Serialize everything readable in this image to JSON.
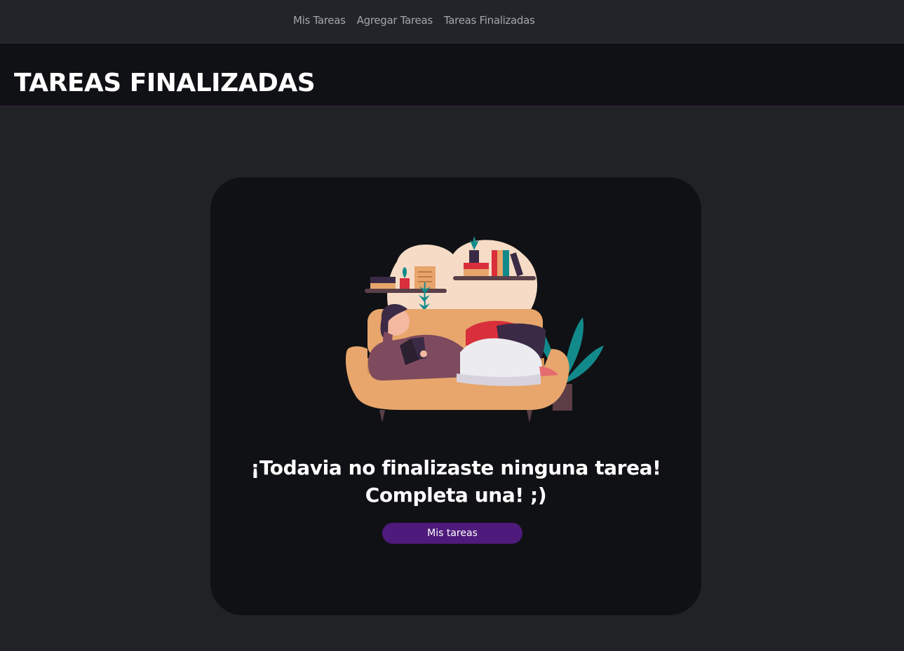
{
  "nav": {
    "items": [
      {
        "label": "Mis Tareas"
      },
      {
        "label": "Agregar Tareas"
      },
      {
        "label": "Tareas Finalizadas"
      }
    ]
  },
  "header": {
    "title": "TAREAS FINALIZADAS"
  },
  "empty_state": {
    "illustration_icon": "woman-reading-on-sofa-illustration",
    "message_line1": "¡Todavia no finalizaste ninguna tarea!",
    "message_line2": "Completa una! ;)",
    "button_label": "Mis tareas"
  },
  "colors": {
    "navbar_bg": "#212429",
    "page_bg": "#212225",
    "header_bg": "#101114",
    "card_bg": "#101114",
    "accent": "#4e1a7c"
  }
}
